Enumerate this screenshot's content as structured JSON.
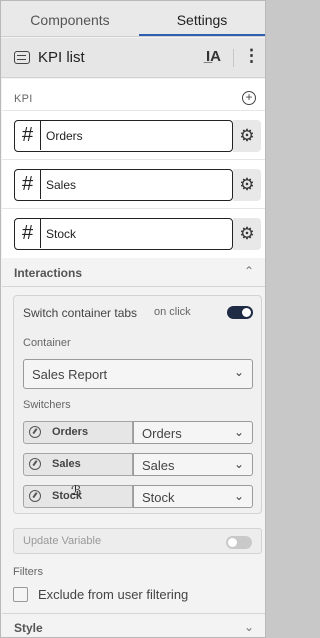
{
  "tabs": [
    {
      "label": "Components",
      "active": false
    },
    {
      "label": "Settings",
      "active": true
    }
  ],
  "header": {
    "title": "KPI list",
    "text_style_icon": "text-style-icon",
    "more_icon": "more-vertical-icon"
  },
  "kpi": {
    "label": "KPI",
    "items": [
      {
        "name": "Orders",
        "icon": "hash-icon"
      },
      {
        "name": "Sales",
        "icon": "hash-icon"
      },
      {
        "name": "Stock",
        "icon": "hash-icon"
      }
    ]
  },
  "interactions": {
    "title": "Interactions",
    "switch_label": "Switch container tabs",
    "trigger": "on click",
    "switch_on": true,
    "container_label": "Container",
    "container_value": "Sales Report",
    "switchers_label": "Switchers",
    "switchers": [
      {
        "kpi": "Orders",
        "tab": "Orders"
      },
      {
        "kpi": "Sales",
        "tab": "Sales"
      },
      {
        "kpi": "Stock",
        "tab": "Stock"
      }
    ],
    "update_variable_label": "Update Variable",
    "update_variable_on": false
  },
  "filters": {
    "label": "Filters",
    "exclude_label": "Exclude from user filtering",
    "exclude_checked": false
  },
  "style": {
    "title": "Style"
  },
  "colors": {
    "accent": "#2f5fb0",
    "toggle_on": "#1f2a44",
    "toggle_off": "#c9c9c9"
  }
}
